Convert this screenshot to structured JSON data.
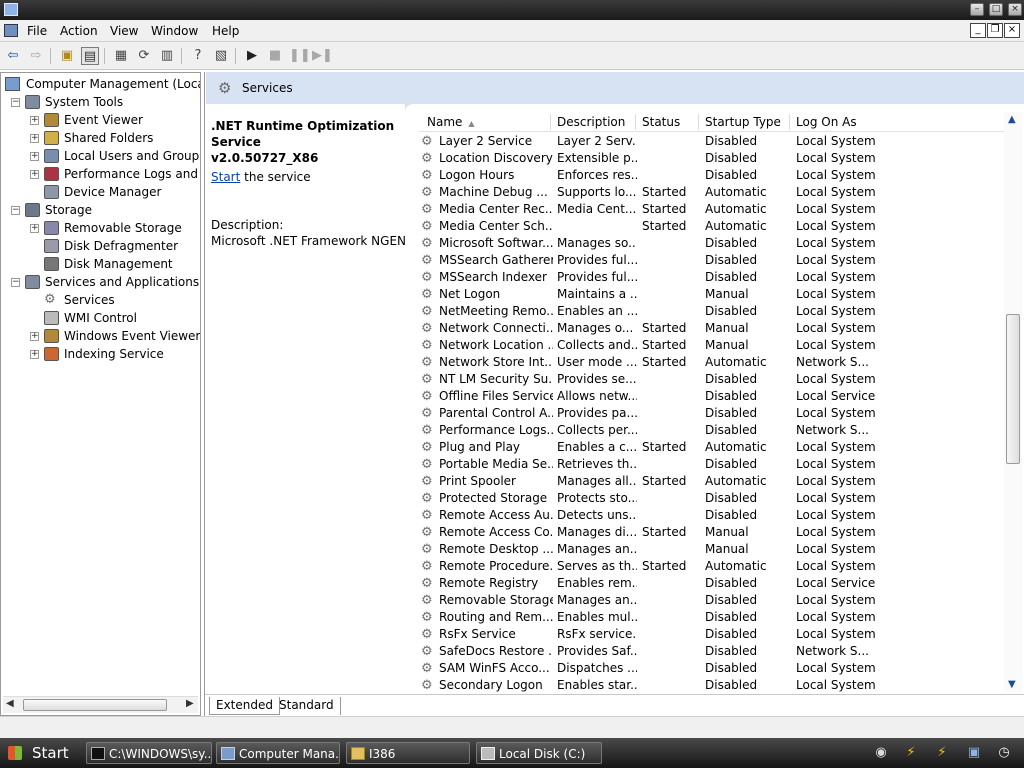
{
  "window": {
    "icons": {
      "app": "computer-management-icon",
      "minimize": "minimize-icon",
      "maximize": "maximize-icon",
      "close": "close-icon"
    }
  },
  "menu": {
    "items": [
      "File",
      "Action",
      "View",
      "Window",
      "Help"
    ],
    "mdi_controls": [
      "minimize-icon",
      "restore-icon",
      "close-icon"
    ]
  },
  "toolbar": {
    "buttons": [
      "back-arrow-icon",
      "forward-arrow-icon",
      "up-folder-icon",
      "show-hide-tree-icon",
      "properties-icon",
      "refresh-icon",
      "export-list-icon",
      "help-icon",
      "console-tree-icon",
      "play-icon",
      "stop-icon",
      "pause-icon"
    ]
  },
  "tree": {
    "root": "Computer Management (Local)",
    "items": [
      {
        "label": "System Tools",
        "icon": "tools-icon"
      },
      {
        "label": "Event Viewer",
        "icon": "event-viewer-icon"
      },
      {
        "label": "Shared Folders",
        "icon": "shared-folder-icon"
      },
      {
        "label": "Local Users and Groups",
        "icon": "users-icon"
      },
      {
        "label": "Performance Logs and Ale",
        "icon": "performance-icon"
      },
      {
        "label": "Device Manager",
        "icon": "device-manager-icon"
      },
      {
        "label": "Storage",
        "icon": "storage-icon"
      },
      {
        "label": "Removable Storage",
        "icon": "removable-storage-icon"
      },
      {
        "label": "Disk Defragmenter",
        "icon": "defrag-icon"
      },
      {
        "label": "Disk Management",
        "icon": "disk-management-icon"
      },
      {
        "label": "Services and Applications",
        "icon": "services-apps-icon"
      },
      {
        "label": "Services",
        "icon": "gear-icon"
      },
      {
        "label": "WMI Control",
        "icon": "wmi-icon"
      },
      {
        "label": "Windows Event Viewer",
        "icon": "event-viewer-icon"
      },
      {
        "label": "Indexing Service",
        "icon": "indexing-icon"
      }
    ]
  },
  "pane": {
    "title": "Services"
  },
  "details": {
    "service_name_line1": ".NET Runtime Optimization Service",
    "service_name_line2": "v2.0.50727_X86",
    "start_link": "Start",
    "start_suffix": " the service",
    "description_label": "Description:",
    "description_text": "Microsoft .NET Framework NGEN"
  },
  "columns": [
    "Name",
    "Description",
    "Status",
    "Startup Type",
    "Log On As"
  ],
  "services": [
    [
      "Layer 2 Service",
      "Layer 2 Serv...",
      "",
      "Disabled",
      "Local System"
    ],
    [
      "Location Discovery",
      "Extensible p...",
      "",
      "Disabled",
      "Local System"
    ],
    [
      "Logon Hours",
      "Enforces res...",
      "",
      "Disabled",
      "Local System"
    ],
    [
      "Machine Debug ...",
      "Supports lo...",
      "Started",
      "Automatic",
      "Local System"
    ],
    [
      "Media Center Rec...",
      "Media Cent...",
      "Started",
      "Automatic",
      "Local System"
    ],
    [
      "Media Center Sch...",
      "",
      "Started",
      "Automatic",
      "Local System"
    ],
    [
      "Microsoft Softwar...",
      "Manages so...",
      "",
      "Disabled",
      "Local System"
    ],
    [
      "MSSearch Gatherer",
      "Provides ful...",
      "",
      "Disabled",
      "Local System"
    ],
    [
      "MSSearch Indexer",
      "Provides ful...",
      "",
      "Disabled",
      "Local System"
    ],
    [
      "Net Logon",
      "Maintains a ...",
      "",
      "Manual",
      "Local System"
    ],
    [
      "NetMeeting Remo...",
      "Enables an ...",
      "",
      "Disabled",
      "Local System"
    ],
    [
      "Network Connecti...",
      "Manages o...",
      "Started",
      "Manual",
      "Local System"
    ],
    [
      "Network Location ...",
      "Collects and...",
      "Started",
      "Manual",
      "Local System"
    ],
    [
      "Network Store Int...",
      "User mode ...",
      "Started",
      "Automatic",
      "Network S..."
    ],
    [
      "NT LM Security Su...",
      "Provides se...",
      "",
      "Disabled",
      "Local System"
    ],
    [
      "Offline Files Service",
      "Allows netw...",
      "",
      "Disabled",
      "Local Service"
    ],
    [
      "Parental Control A...",
      "Provides pa...",
      "",
      "Disabled",
      "Local System"
    ],
    [
      "Performance Logs...",
      "Collects per...",
      "",
      "Disabled",
      "Network S..."
    ],
    [
      "Plug and Play",
      "Enables a c...",
      "Started",
      "Automatic",
      "Local System"
    ],
    [
      "Portable Media Se...",
      "Retrieves th...",
      "",
      "Disabled",
      "Local System"
    ],
    [
      "Print Spooler",
      "Manages all...",
      "Started",
      "Automatic",
      "Local System"
    ],
    [
      "Protected Storage",
      "Protects sto...",
      "",
      "Disabled",
      "Local System"
    ],
    [
      "Remote Access Au...",
      "Detects uns...",
      "",
      "Disabled",
      "Local System"
    ],
    [
      "Remote Access Co...",
      "Manages di...",
      "Started",
      "Manual",
      "Local System"
    ],
    [
      "Remote Desktop ...",
      "Manages an...",
      "",
      "Manual",
      "Local System"
    ],
    [
      "Remote Procedure...",
      "Serves as th...",
      "Started",
      "Automatic",
      "Local System"
    ],
    [
      "Remote Registry",
      "Enables rem...",
      "",
      "Disabled",
      "Local Service"
    ],
    [
      "Removable Storage",
      "Manages an...",
      "",
      "Disabled",
      "Local System"
    ],
    [
      "Routing and Rem...",
      "Enables mul...",
      "",
      "Disabled",
      "Local System"
    ],
    [
      "RsFx Service",
      "RsFx service...",
      "",
      "Disabled",
      "Local System"
    ],
    [
      "SafeDocs Restore ...",
      "Provides Saf...",
      "",
      "Disabled",
      "Network S..."
    ],
    [
      "SAM WinFS Acco...",
      "Dispatches ...",
      "",
      "Disabled",
      "Local System"
    ],
    [
      "Secondary Logon",
      "Enables star...",
      "",
      "Disabled",
      "Local System"
    ]
  ],
  "tabs": [
    "Extended",
    "Standard"
  ],
  "taskbar": {
    "start": "Start",
    "tasks": [
      {
        "label": "C:\\WINDOWS\\sy...",
        "icon": "cmd-icon"
      },
      {
        "label": "Computer Mana...",
        "icon": "computer-management-icon"
      },
      {
        "label": "I386",
        "icon": "folder-icon"
      },
      {
        "label": "Local Disk (C:)",
        "icon": "drive-icon"
      }
    ],
    "tray_icons": [
      "search-icon",
      "lightning-icon",
      "flash-icon",
      "network-icon",
      "clock-icon",
      "globe-icon"
    ]
  }
}
